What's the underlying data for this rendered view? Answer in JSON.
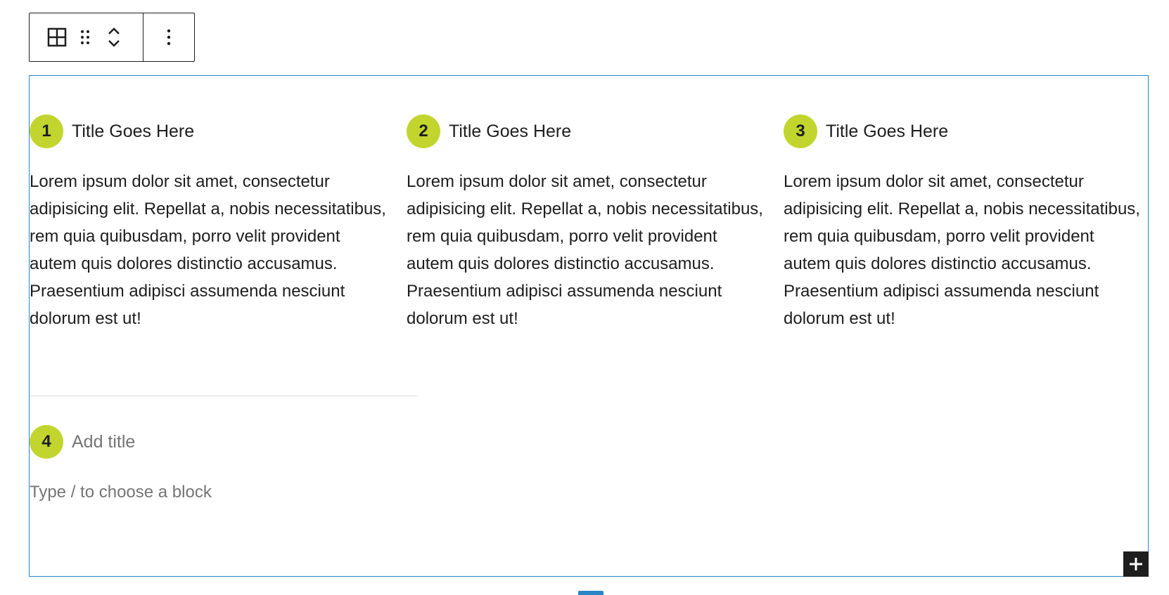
{
  "toolbar": {
    "block_type_icon": "table-grid-icon",
    "drag_icon": "drag-handle-icon",
    "move_up_icon": "chevron-up-icon",
    "move_down_icon": "chevron-down-icon",
    "more_icon": "more-vertical-icon"
  },
  "colors": {
    "accent": "#c2d52e",
    "selection_border": "#2a86c5",
    "text": "#1e1e1e",
    "placeholder": "#757575"
  },
  "items": [
    {
      "number": "1",
      "title": "Title Goes Here",
      "body": "Lorem ipsum dolor sit amet, consectetur adipisicing elit. Repellat a, nobis necessitatibus, rem quia quibusdam, porro velit provident autem quis dolores distinctio accusamus. Praesentium adipisci assumenda nesciunt dolorum est ut!"
    },
    {
      "number": "2",
      "title": "Title Goes Here",
      "body": "Lorem ipsum dolor sit amet, consectetur adipisicing elit. Repellat a, nobis necessitatibus, rem quia quibusdam, porro velit provident autem quis dolores distinctio accusamus. Praesentium adipisci assumenda nesciunt dolorum est ut!"
    },
    {
      "number": "3",
      "title": "Title Goes Here",
      "body": "Lorem ipsum dolor sit amet, consectetur adipisicing elit. Repellat a, nobis necessitatibus, rem quia quibusdam, porro velit provident autem quis dolores distinctio accusamus. Praesentium adipisci assumenda nesciunt dolorum est ut!"
    },
    {
      "number": "4",
      "title_placeholder": "Add title",
      "body_placeholder": "Type / to choose a block"
    }
  ],
  "inserter": {
    "icon": "plus-icon"
  }
}
